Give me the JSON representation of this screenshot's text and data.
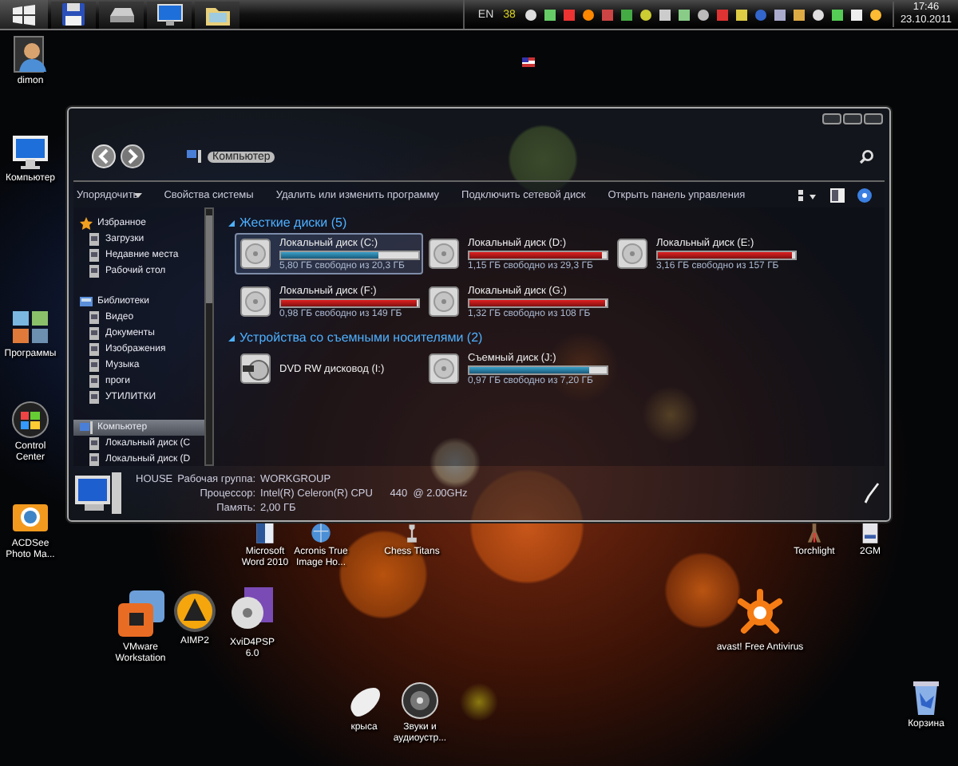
{
  "taskbar": {
    "language": "EN",
    "counter": "38",
    "time": "17:46",
    "date": "23.10.2011"
  },
  "desktop_icons": [
    {
      "label": "dimon"
    },
    {
      "label": "Компьютер"
    },
    {
      "label": "Программы"
    },
    {
      "label": "Control Center"
    },
    {
      "label": "ACDSee Photo Ma..."
    },
    {
      "label": "Microsoft Word 2010"
    },
    {
      "label": "Acronis True Image Ho..."
    },
    {
      "label": "Chess Titans"
    },
    {
      "label": "Torchlight"
    },
    {
      "label": "2GM"
    },
    {
      "label": "VMware Workstation"
    },
    {
      "label": "AIMP2"
    },
    {
      "label": "XviD4PSP 6.0"
    },
    {
      "label": "avast! Free Antivirus"
    },
    {
      "label": "крыса"
    },
    {
      "label": "Звуки и аудиоустр..."
    },
    {
      "label": "Корзина"
    }
  ],
  "window": {
    "address": {
      "path": "Компьютер"
    },
    "toolbar": [
      {
        "label": "Упорядочить",
        "menu": true
      },
      {
        "label": "Свойства системы",
        "menu": false
      },
      {
        "label": "Удалить или изменить программу",
        "menu": false
      },
      {
        "label": "Подключить сетевой диск",
        "menu": false
      },
      {
        "label": "Открыть панель управления",
        "menu": false
      }
    ],
    "nav": [
      {
        "label": "Избранное",
        "selected": false,
        "children": [
          {
            "label": "Загрузки",
            "selected": false
          },
          {
            "label": "Недавние места",
            "selected": false
          },
          {
            "label": "Рабочий стол",
            "selected": false
          }
        ]
      },
      {
        "label": "Библиотеки",
        "selected": false,
        "children": [
          {
            "label": "Видео",
            "selected": false
          },
          {
            "label": "Документы",
            "selected": false
          },
          {
            "label": "Изображения",
            "selected": false
          },
          {
            "label": "Музыка",
            "selected": false
          },
          {
            "label": "проги",
            "selected": false
          },
          {
            "label": "УТИЛИТКИ",
            "selected": false
          }
        ]
      },
      {
        "label": "Компьютер",
        "selected": true,
        "children": [
          {
            "label": "Локальный диск (C",
            "selected": false
          },
          {
            "label": "Локальный диск (D",
            "selected": false
          }
        ]
      }
    ],
    "sections": [
      {
        "title": "Жесткие диски (5)",
        "drives": [
          {
            "kind": "disk",
            "name": "Локальный диск (C:)",
            "free": "5,80 ГБ свободно из 20,3 ГБ",
            "level": 0.71,
            "warning": false,
            "selected": true
          },
          {
            "kind": "disk",
            "name": "Локальный диск (D:)",
            "free": "1,15 ГБ свободно из 29,3 ГБ",
            "level": 0.96,
            "warning": true,
            "selected": false
          },
          {
            "kind": "disk",
            "name": "Локальный диск (E:)",
            "free": "3,16 ГБ свободно из 157 ГБ",
            "level": 0.98,
            "warning": true,
            "selected": false
          },
          {
            "kind": "disk",
            "name": "Локальный диск (F:)",
            "free": "0,98 ГБ свободно из 149 ГБ",
            "level": 0.99,
            "warning": true,
            "selected": false
          },
          {
            "kind": "disk",
            "name": "Локальный диск (G:)",
            "free": "1,32 ГБ свободно из 108 ГБ",
            "level": 0.99,
            "warning": true,
            "selected": false
          }
        ]
      },
      {
        "title": "Устройства со съемными носителями (2)",
        "drives": [
          {
            "kind": "optical",
            "name": "DVD RW дисковод (I:)",
            "selected": false
          },
          {
            "kind": "disk",
            "name": "Съемный диск (J:)",
            "free": "0,97 ГБ свободно из 7,20 ГБ",
            "level": 0.87,
            "warning": false,
            "selected": false
          }
        ]
      }
    ],
    "details": {
      "computer": "HOUSE",
      "fields": [
        {
          "label": "Рабочая группа:",
          "value": "WORKGROUP"
        },
        {
          "label": "Процессор:",
          "value": "Intel(R) Celeron(R) CPU      440  @ 2.00GHz"
        },
        {
          "label": "Память:",
          "value": "2,00 ГБ"
        }
      ]
    }
  }
}
